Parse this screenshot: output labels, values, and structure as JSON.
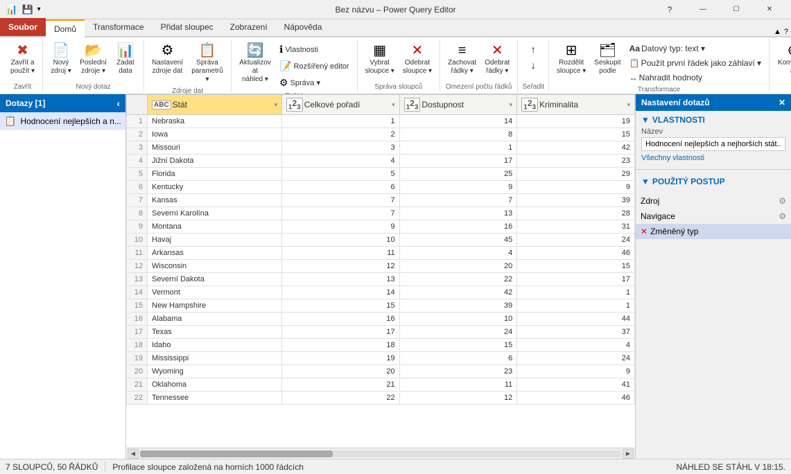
{
  "titlebar": {
    "title": "Bez názvu – Power Query Editor",
    "minimize": "—",
    "maximize": "☐",
    "close": "✕"
  },
  "ribbon": {
    "tabs": [
      "Soubor",
      "Domů",
      "Transformace",
      "Přidat sloupec",
      "Zobrazení",
      "Nápověda"
    ],
    "active_tab": "Domů",
    "groups": [
      {
        "name": "Zavřít",
        "buttons": [
          {
            "id": "zavrit-a-pouzit",
            "icon": "💾",
            "label": "Zavřít a\npouižít ▾"
          }
        ]
      },
      {
        "name": "Nový dotaz",
        "buttons": [
          {
            "id": "novy-zdroj",
            "icon": "📄",
            "label": "Nový\nzdroj ▾"
          },
          {
            "id": "posledni-zdroje",
            "icon": "📂",
            "label": "Poslední\nzdroje ▾"
          },
          {
            "id": "zadat-data",
            "icon": "📊",
            "label": "Zadat\ndata"
          }
        ]
      },
      {
        "name": "Zdroje dat",
        "buttons": [
          {
            "id": "nastaveni-zdroje-dat",
            "icon": "⚙",
            "label": "Nastavení\nzdroje dat"
          },
          {
            "id": "sprava-parametru",
            "icon": "📋",
            "label": "Správa\nparametrů ▾"
          }
        ]
      },
      {
        "name": "Dotaz",
        "buttons": [
          {
            "id": "aktualizovat-nahled",
            "icon": "🔄",
            "label": "Aktualizovat\nnáhled ▾"
          },
          {
            "id": "vlastnosti",
            "icon": "ℹ",
            "label": "Vlastnosti"
          },
          {
            "id": "rozsireny-editor",
            "icon": "📝",
            "label": "Rozšířený editor"
          },
          {
            "id": "sprava",
            "icon": "⚙",
            "label": "Správa ▾"
          }
        ]
      },
      {
        "name": "Správa sloupců",
        "buttons": [
          {
            "id": "vybrat-sloupce",
            "icon": "▦",
            "label": "Vybrat\nsloupce ▾"
          },
          {
            "id": "odebrat-sloupce",
            "icon": "✕",
            "label": "Odebrat\nsloupce ▾"
          }
        ]
      },
      {
        "name": "Omezení počtu řádků",
        "buttons": [
          {
            "id": "zachovat-radky",
            "icon": "≡",
            "label": "Zachovat\nřádky ▾"
          },
          {
            "id": "odebrat-radky",
            "icon": "✕",
            "label": "Odebrat\nřádky ▾"
          }
        ]
      },
      {
        "name": "Seřadit",
        "buttons": [
          {
            "id": "razdit-vzestupne",
            "icon": "↑",
            "label": ""
          },
          {
            "id": "razdit-sestupne",
            "icon": "↓",
            "label": ""
          }
        ]
      },
      {
        "name": "Transformace",
        "buttons": [
          {
            "id": "rozdelit-sloupce",
            "icon": "⊞",
            "label": "Rozdělit\nsloupce ▾"
          },
          {
            "id": "seskupit-podle",
            "icon": "🗂",
            "label": "Seskupit\npodle"
          },
          {
            "id": "datovy-typ",
            "icon": "Aa",
            "label": "Datový typ: text ▾"
          },
          {
            "id": "prvni-radek",
            "icon": "📋",
            "label": "Použít první řádek jako záhlaví ▾"
          },
          {
            "id": "nahradit-hodnoty",
            "icon": "↔",
            "label": "Nahradit hodnoty"
          }
        ]
      },
      {
        "name": "",
        "buttons": [
          {
            "id": "kombinovat",
            "icon": "⊕",
            "label": "Kombinovat"
          }
        ]
      }
    ]
  },
  "queries_panel": {
    "title": "Dotazy [1]",
    "items": [
      {
        "id": "hodnoceni",
        "label": "Hodnocení nejlepších a n...",
        "icon": "📋"
      }
    ]
  },
  "table": {
    "columns": [
      {
        "id": "stat",
        "label": "Stát",
        "type": "ABC",
        "active": true
      },
      {
        "id": "celkove-poradi",
        "label": "Celkové pořadí",
        "type": "123"
      },
      {
        "id": "dostupnost",
        "label": "Dostupnost",
        "type": "123"
      },
      {
        "id": "kriminalita",
        "label": "Kriminalita",
        "type": "123"
      }
    ],
    "rows": [
      {
        "num": 1,
        "stat": "Nebraska",
        "celkove": 1,
        "dostupnost": 14,
        "kriminalita": 19
      },
      {
        "num": 2,
        "stat": "Iowa",
        "celkove": 2,
        "dostupnost": 8,
        "kriminalita": 15
      },
      {
        "num": 3,
        "stat": "Missouri",
        "celkove": 3,
        "dostupnost": 1,
        "kriminalita": 42
      },
      {
        "num": 4,
        "stat": "Jižní Dakota",
        "celkove": 4,
        "dostupnost": 17,
        "kriminalita": 23
      },
      {
        "num": 5,
        "stat": "Florida",
        "celkove": 5,
        "dostupnost": 25,
        "kriminalita": 29
      },
      {
        "num": 6,
        "stat": "Kentucky",
        "celkove": 6,
        "dostupnost": 9,
        "kriminalita": 9
      },
      {
        "num": 7,
        "stat": "Kansas",
        "celkove": 7,
        "dostupnost": 7,
        "kriminalita": 39
      },
      {
        "num": 8,
        "stat": "Severní Karolína",
        "celkove": 7,
        "dostupnost": 13,
        "kriminalita": 28
      },
      {
        "num": 9,
        "stat": "Montana",
        "celkove": 9,
        "dostupnost": 16,
        "kriminalita": 31
      },
      {
        "num": 10,
        "stat": "Havaj",
        "celkove": 10,
        "dostupnost": 45,
        "kriminalita": 24
      },
      {
        "num": 11,
        "stat": "Arkansas",
        "celkove": 11,
        "dostupnost": 4,
        "kriminalita": 46
      },
      {
        "num": 12,
        "stat": "Wisconsin",
        "celkove": 12,
        "dostupnost": 20,
        "kriminalita": 15
      },
      {
        "num": 13,
        "stat": "Severní Dakota",
        "celkove": 13,
        "dostupnost": 22,
        "kriminalita": 17
      },
      {
        "num": 14,
        "stat": "Vermont",
        "celkove": 14,
        "dostupnost": 42,
        "kriminalita": 1
      },
      {
        "num": 15,
        "stat": "New Hampshire",
        "celkove": 15,
        "dostupnost": 39,
        "kriminalita": 1
      },
      {
        "num": 16,
        "stat": "Alabama",
        "celkove": 16,
        "dostupnost": 10,
        "kriminalita": 44
      },
      {
        "num": 17,
        "stat": "Texas",
        "celkove": 17,
        "dostupnost": 24,
        "kriminalita": 37
      },
      {
        "num": 18,
        "stat": "Idaho",
        "celkove": 18,
        "dostupnost": 15,
        "kriminalita": 4
      },
      {
        "num": 19,
        "stat": "Mississippi",
        "celkove": 19,
        "dostupnost": 6,
        "kriminalita": 24
      },
      {
        "num": 20,
        "stat": "Wyoming",
        "celkove": 20,
        "dostupnost": 23,
        "kriminalita": 9
      },
      {
        "num": 21,
        "stat": "Oklahoma",
        "celkove": 21,
        "dostupnost": 11,
        "kriminalita": 41
      },
      {
        "num": 22,
        "stat": "Tennessee",
        "celkove": 22,
        "dostupnost": 12,
        "kriminalita": 46
      }
    ]
  },
  "right_panel": {
    "title": "Nastavení dotazů",
    "properties_label": "VLASTNOSTI",
    "name_label": "Název",
    "name_value": "Hodnocení nejlepších a nejhorších stát...",
    "all_properties_link": "Všechny vlastnosti",
    "steps_label": "POUŽITÝ POSTUP",
    "steps": [
      {
        "id": "zdroj",
        "label": "Zdroj",
        "has_gear": true,
        "active": false,
        "error": false
      },
      {
        "id": "navigace",
        "label": "Navigace",
        "has_gear": true,
        "active": false,
        "error": false
      },
      {
        "id": "zmeneny-typ",
        "label": "Změněný typ",
        "has_gear": false,
        "active": true,
        "error": true
      }
    ]
  },
  "statusbar": {
    "columns": "7 SLOUPCŮ, 50 ŘÁDKŮ",
    "profile_info": "Profilace sloupce založená na horních 1000 řádcích",
    "nahled_info": "NÁHLED SE STÁHL V 18:15."
  }
}
